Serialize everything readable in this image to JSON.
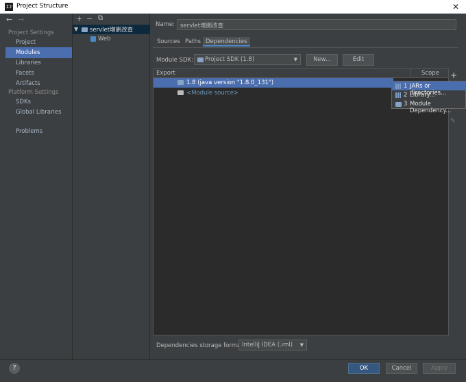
{
  "window": {
    "title": "Project Structure",
    "close": "✕"
  },
  "leftnav": {
    "back": "←",
    "forward": "→",
    "project_settings_header": "Project Settings",
    "project_settings": [
      "Project",
      "Modules",
      "Libraries",
      "Facets",
      "Artifacts"
    ],
    "platform_settings_header": "Platform Settings",
    "platform_settings": [
      "SDKs",
      "Global Libraries"
    ],
    "problems": "Problems"
  },
  "tree": {
    "add": "+",
    "remove": "−",
    "copy": "⧉",
    "module": "servlet增删改查",
    "facet": "Web"
  },
  "module": {
    "name_label": "Name:",
    "name_value": "servlet增删改查",
    "tabs": [
      "Sources",
      "Paths",
      "Dependencies"
    ],
    "active_tab": "Dependencies",
    "sdk_label": "Module SDK:",
    "sdk_value": "Project SDK (1.8)",
    "new_button": "New...",
    "edit_button": "Edit"
  },
  "deps": {
    "col_export": "Export",
    "col_scope": "Scope",
    "rows": [
      "1.8 (java version \"1.8.0_131\")",
      "<Module source>"
    ],
    "plus": "+",
    "storage_label": "Dependencies storage format:",
    "storage_value": "IntelliJ IDEA (.iml)"
  },
  "popup": {
    "items": [
      {
        "num": "1",
        "label": "JARs or directories..."
      },
      {
        "num": "2",
        "label": "Library..."
      },
      {
        "num": "3",
        "label": "Module Dependency..."
      }
    ]
  },
  "footer": {
    "help": "?",
    "ok": "OK",
    "cancel": "Cancel",
    "apply": "Apply"
  }
}
